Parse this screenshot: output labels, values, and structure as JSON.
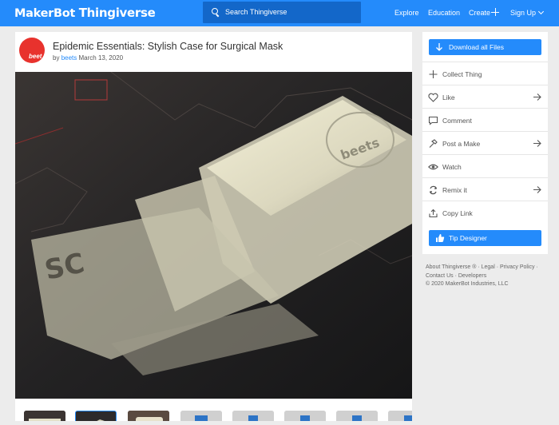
{
  "header": {
    "logo": "MakerBot Thingiverse",
    "logo_brand": "MakerBot",
    "logo_product": "Thingiverse",
    "search_placeholder": "Search Thingiverse",
    "nav": [
      "Explore",
      "Education",
      "Create",
      "Sign Up"
    ],
    "icons": [
      "search-icon",
      "plus-icon",
      "chevron-down-icon"
    ]
  },
  "thing": {
    "title": "Epidemic Essentials: Stylish Case for Surgical Mask",
    "by": "by",
    "author": "beets",
    "date": "March 13, 2020",
    "avatar_text": "beet"
  },
  "gallery": {
    "thumbnails": [
      "photo",
      "photo",
      "photo",
      "blue-render",
      "blue-render",
      "blue-render",
      "blue-render",
      "blue-render"
    ],
    "selected_index": 1
  },
  "sidebar": {
    "download_label": "Download all Files",
    "actions": [
      {
        "label": "Collect Thing",
        "icon": "plus-icon",
        "arrow": false
      },
      {
        "label": "Like",
        "icon": "heart-icon",
        "arrow": true
      },
      {
        "label": "Comment",
        "icon": "comment-icon",
        "arrow": false
      },
      {
        "label": "Post a Make",
        "icon": "hammer-icon",
        "arrow": true
      },
      {
        "label": "Watch",
        "icon": "eye-icon",
        "arrow": false
      },
      {
        "label": "Remix it",
        "icon": "remix-icon",
        "arrow": true
      },
      {
        "label": "Copy Link",
        "icon": "share-icon",
        "arrow": false
      }
    ],
    "tip_label": "Tip Designer"
  },
  "footer": {
    "line1": "About Thingiverse ® · Legal · Privacy Policy ·",
    "line2": "Contact Us · Developers",
    "line3": "© 2020 MakerBot Industries, LLC"
  },
  "colors": {
    "accent": "#248bfb",
    "search_bg": "#1367c9",
    "page_bg": "#ececec",
    "avatar": "#e8322d"
  }
}
